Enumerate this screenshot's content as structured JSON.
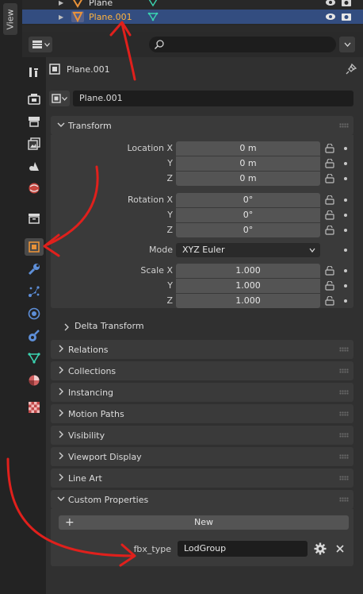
{
  "sidebar_tab": {
    "label": "View"
  },
  "outliner": {
    "rows": [
      {
        "name": "Plane",
        "selected": false
      },
      {
        "name": "Plane.001",
        "selected": true
      }
    ]
  },
  "header": {
    "search_placeholder": ""
  },
  "context": {
    "object_name": "Plane.001",
    "datablock_name": "Plane.001"
  },
  "tabs": [
    {
      "name": "tool-tab",
      "icon": "tool-icon"
    },
    {
      "name": "render-tab",
      "icon": "render-icon"
    },
    {
      "name": "output-tab",
      "icon": "output-icon"
    },
    {
      "name": "view-layer-tab",
      "icon": "view-layer-icon"
    },
    {
      "name": "scene-tab",
      "icon": "scene-icon"
    },
    {
      "name": "world-tab",
      "icon": "world-icon"
    },
    {
      "name": "collection-tab",
      "icon": "collection-icon"
    },
    {
      "name": "object-tab",
      "icon": "object-icon",
      "active": true
    },
    {
      "name": "modifiers-tab",
      "icon": "wrench-icon"
    },
    {
      "name": "particles-tab",
      "icon": "particles-icon"
    },
    {
      "name": "physics-tab",
      "icon": "physics-icon"
    },
    {
      "name": "constraints-tab",
      "icon": "constraints-icon"
    },
    {
      "name": "data-tab",
      "icon": "mesh-data-icon"
    },
    {
      "name": "material-tab",
      "icon": "material-icon"
    },
    {
      "name": "texture-tab",
      "icon": "texture-icon"
    }
  ],
  "transform": {
    "title": "Transform",
    "location_label": "Location X",
    "y_label": "Y",
    "z_label": "Z",
    "location": [
      "0 m",
      "0 m",
      "0 m"
    ],
    "rotation_label": "Rotation X",
    "rotation": [
      "0°",
      "0°",
      "0°"
    ],
    "mode_label": "Mode",
    "mode_value": "XYZ Euler",
    "scale_label": "Scale X",
    "scale": [
      "1.000",
      "1.000",
      "1.000"
    ],
    "delta_label": "Delta Transform"
  },
  "panels": [
    "Relations",
    "Collections",
    "Instancing",
    "Motion Paths",
    "Visibility",
    "Viewport Display",
    "Line Art"
  ],
  "custom_properties": {
    "title": "Custom Properties",
    "new_label": "New",
    "prop_name": "fbx_type",
    "prop_value": "LodGroup"
  },
  "colors": {
    "accent_orange": "#ffb33d",
    "selection_blue": "#334d80",
    "annotation_red": "#e0201c",
    "mesh_green": "#3bd3b0"
  }
}
